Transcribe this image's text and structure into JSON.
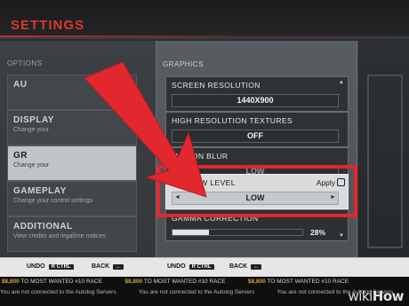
{
  "header": {
    "title": "SETTINGS"
  },
  "options": {
    "header": "OPTIONS",
    "items": [
      {
        "title": "AU",
        "sub": ""
      },
      {
        "title": "DISPLAY",
        "sub": "Change your"
      },
      {
        "title": "GR",
        "sub": "Change your"
      },
      {
        "title": "GAMEPLAY",
        "sub": "Change your control settings"
      },
      {
        "title": "ADDITIONAL",
        "sub": "View credits and legal/me notices"
      }
    ]
  },
  "graphics": {
    "header": "GRAPHICS",
    "settings": [
      {
        "label": "SCREEN RESOLUTION",
        "value": "1440X900"
      },
      {
        "label": "HIGH RESOLUTION TEXTURES",
        "value": "OFF"
      },
      {
        "label": "MOTION BLUR",
        "value": "LOW"
      },
      {
        "label": "SHADOW LEVEL",
        "value": "LOW",
        "apply": "Apply"
      },
      {
        "label": "GAMMA CORRECTION",
        "value": "28%",
        "level": 0.28
      }
    ]
  },
  "footer": {
    "undo_label": "UNDO",
    "undo_key": "R CTRL",
    "back_label": "BACK",
    "back_key": "←"
  },
  "ticker": {
    "amount": "$8,800",
    "message": "TO MOST WANTED #10 RACE",
    "server_message": "You are not connected to the Autolog Servers"
  },
  "watermark": {
    "wiki": "wiki",
    "how": "How"
  },
  "colors": {
    "accent_red": "#e2272e",
    "title_red": "#e0362f",
    "ticker_gold": "#d4a62a"
  }
}
